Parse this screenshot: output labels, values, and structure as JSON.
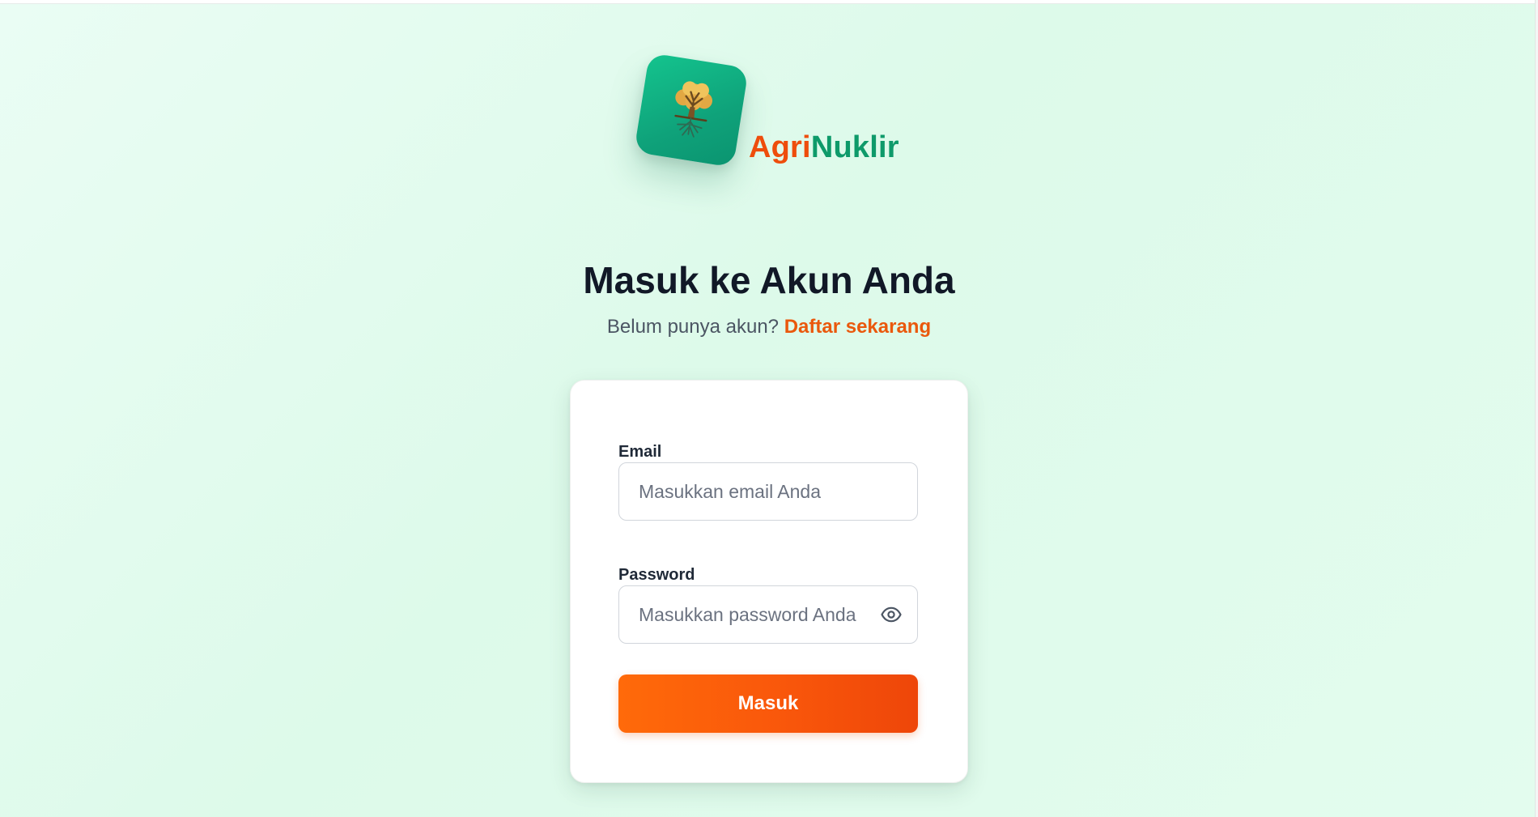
{
  "brand": {
    "name_part1": "Agri",
    "name_part2": "Nuklir",
    "logo_icon": "tree-icon",
    "color_primary": "#ee4d0c",
    "color_secondary": "#0e9a6a"
  },
  "header": {
    "title": "Masuk ke Akun Anda",
    "subtitle_prefix": "Belum punya akun?",
    "register_link": "Daftar sekarang"
  },
  "form": {
    "email": {
      "label": "Email",
      "placeholder": "Masukkan email Anda",
      "value": ""
    },
    "password": {
      "label": "Password",
      "placeholder": "Masukkan password Anda",
      "value": "",
      "toggle_icon": "eye-icon"
    },
    "submit_label": "Masuk"
  },
  "colors": {
    "accent": "#ea580c",
    "button_gradient_start": "#ff6a0a",
    "button_gradient_end": "#ee4609",
    "background": "#e3fcee",
    "title": "#111827"
  }
}
